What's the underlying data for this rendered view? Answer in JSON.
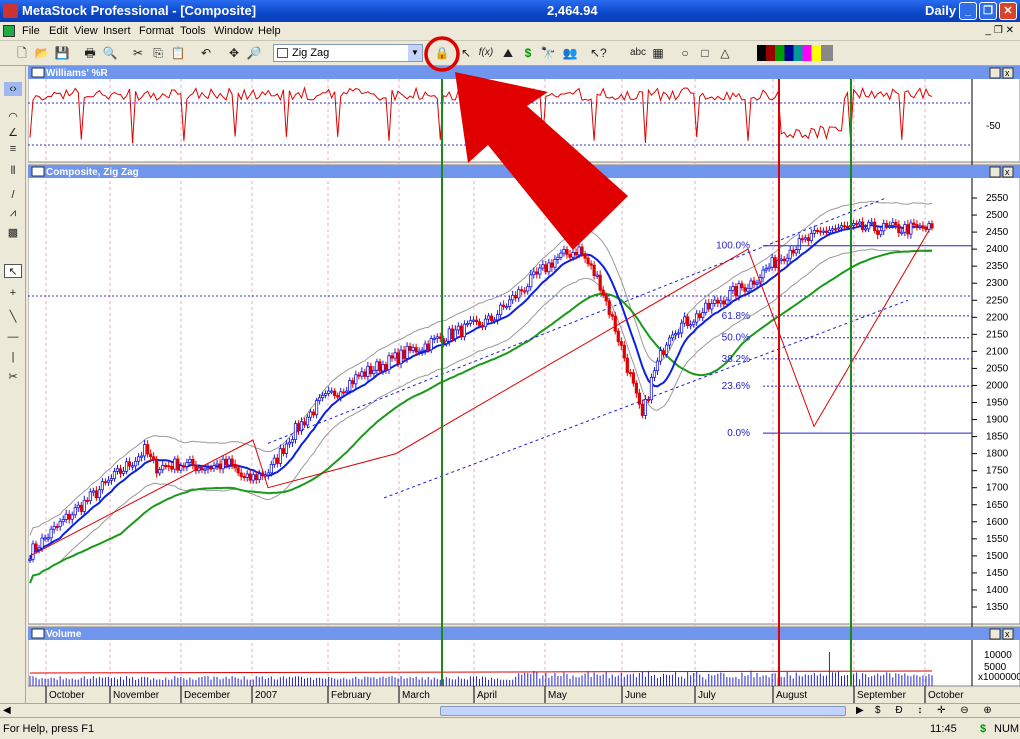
{
  "app": {
    "title": "MetaStock Professional - [Composite]",
    "value": "2,464.94",
    "period": "Daily"
  },
  "menu": [
    "File",
    "Edit",
    "View",
    "Insert",
    "Format",
    "Tools",
    "Window",
    "Help"
  ],
  "toolbar": {
    "indicator_select": "Zig Zag",
    "text_tool": "abc"
  },
  "panes": {
    "williams": {
      "title": "Williams' %R",
      "tick": "-50"
    },
    "price": {
      "title": "Composite, Zig Zag",
      "ticks": [
        "2550",
        "2500",
        "2450",
        "2400",
        "2350",
        "2300",
        "2250",
        "2200",
        "2150",
        "2100",
        "2050",
        "2000",
        "1950",
        "1900",
        "1850",
        "1800",
        "1750",
        "1700",
        "1650",
        "1600",
        "1550",
        "1500",
        "1450",
        "1400",
        "1350"
      ]
    },
    "volume": {
      "title": "Volume",
      "ticks": [
        "10000",
        "5000"
      ],
      "unit": "x1000000"
    }
  },
  "fib": [
    "100.0%",
    "61.8%",
    "50.0%",
    "38.2%",
    "23.6%",
    "0.0%"
  ],
  "months": [
    "October",
    "November",
    "December",
    "2007",
    "February",
    "March",
    "April",
    "May",
    "June",
    "July",
    "August",
    "September",
    "October"
  ],
  "status": {
    "help": "For Help, press F1",
    "time": "11:45",
    "dollar": "$",
    "num": "NUM"
  },
  "icons": {
    "annotation": "red-arrow-pointing-to-circled-toolbar-button"
  },
  "colors": {
    "title": "#0a46c8",
    "up": "#1b1be0",
    "down": "#e00000",
    "ma_blue": "#0a20e0",
    "ma_green": "#1a9a1a",
    "highlight": "#e00000"
  }
}
